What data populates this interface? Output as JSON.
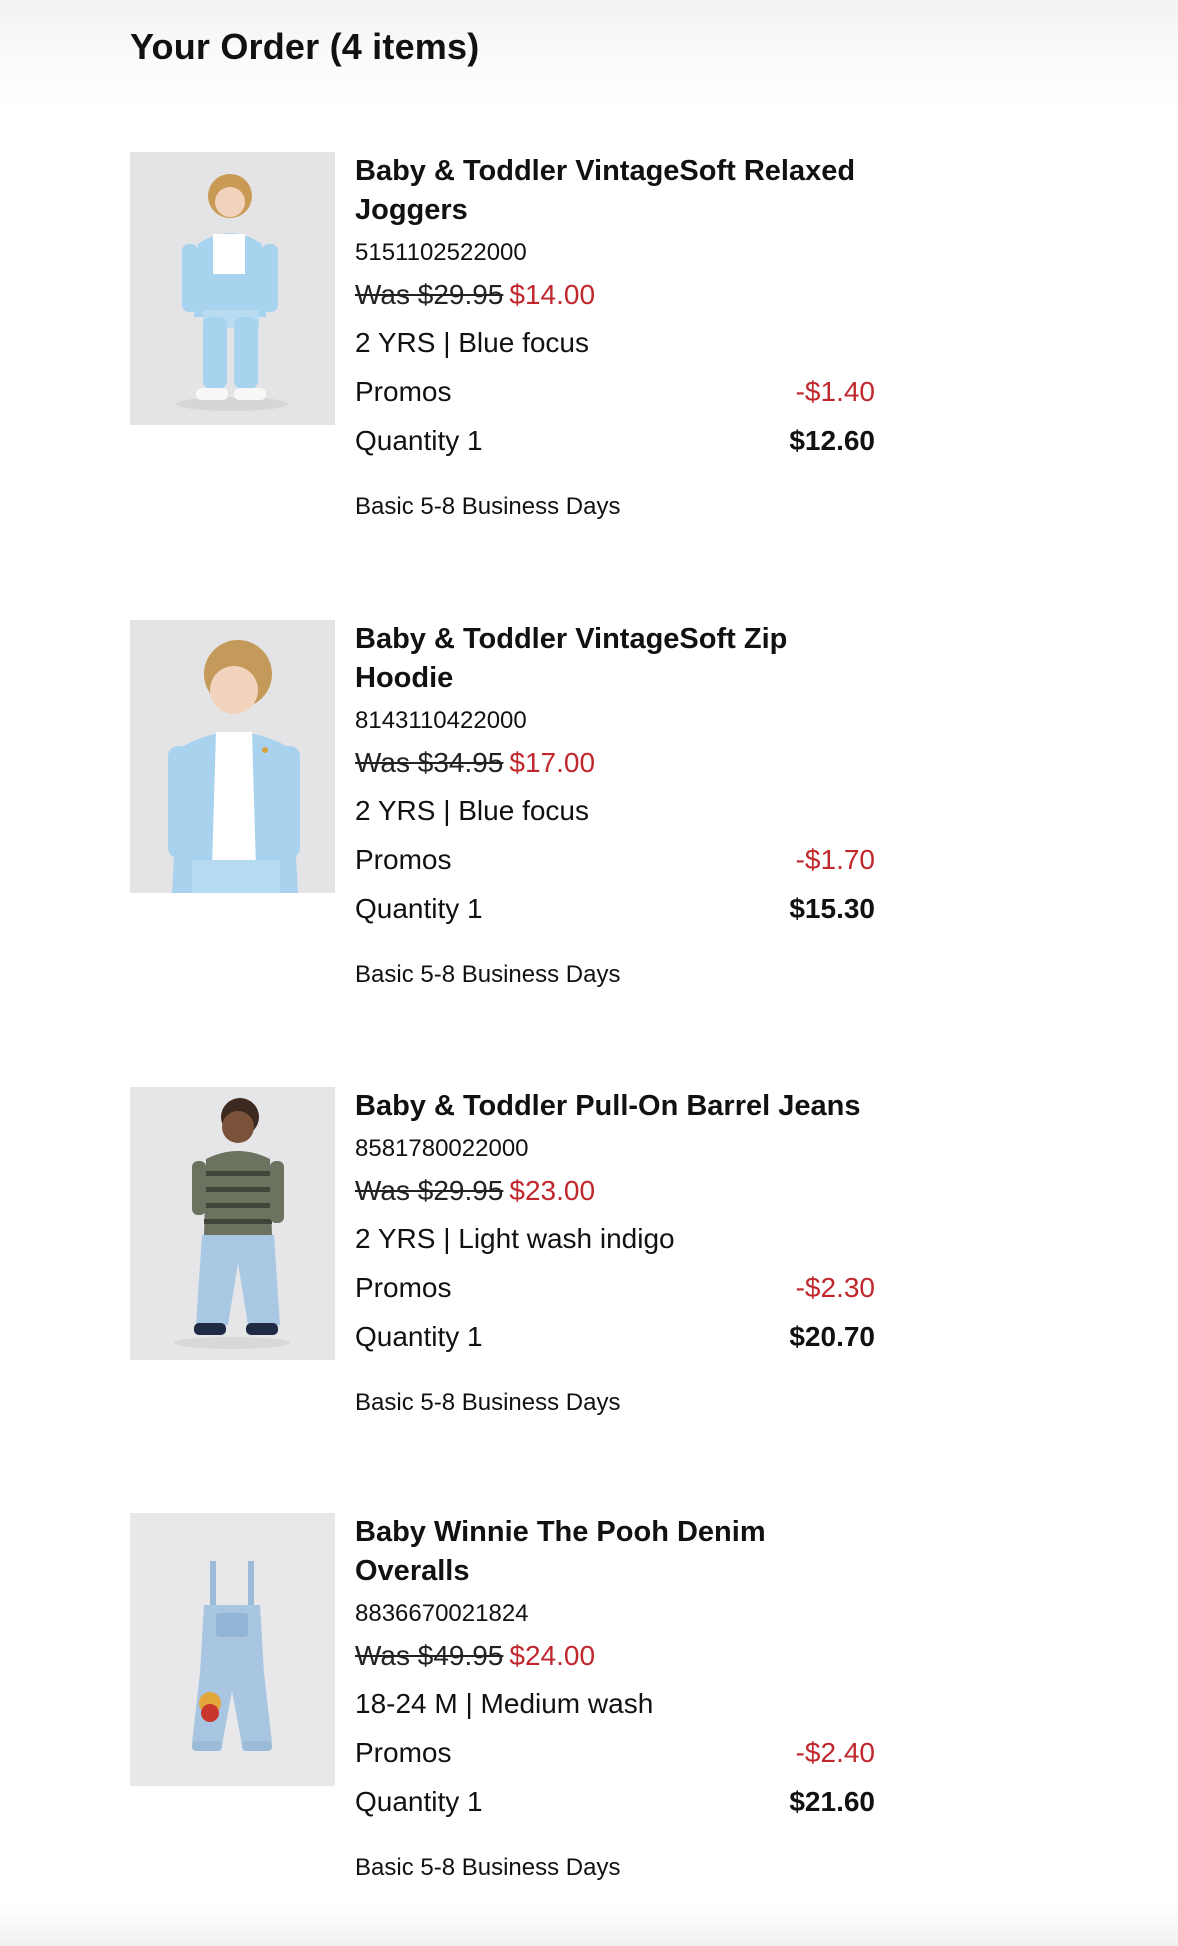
{
  "header": {
    "title": "Your Order (4 items)"
  },
  "items": [
    {
      "name": "Baby & Toddler VintageSoft Relaxed Joggers",
      "sku": "5151102522000",
      "was_price": "Was $29.95",
      "sale_price": "$14.00",
      "variant": "2 YRS | Blue focus",
      "promos_label": "Promos",
      "promos_value": "-$1.40",
      "quantity_label": "Quantity 1",
      "line_total": "$12.60",
      "shipping": "Basic 5-8 Business Days",
      "image": "toddler-blue-joggers-outfit"
    },
    {
      "name": "Baby & Toddler VintageSoft Zip Hoodie",
      "sku": "8143110422000",
      "was_price": "Was $34.95",
      "sale_price": "$17.00",
      "variant": "2 YRS | Blue focus",
      "promos_label": "Promos",
      "promos_value": "-$1.70",
      "quantity_label": "Quantity 1",
      "line_total": "$15.30",
      "shipping": "Basic 5-8 Business Days",
      "image": "toddler-blue-zip-hoodie"
    },
    {
      "name": "Baby & Toddler Pull-On Barrel Jeans",
      "sku": "8581780022000",
      "was_price": "Was $29.95",
      "sale_price": "$23.00",
      "variant": "2 YRS | Light wash indigo",
      "promos_label": "Promos",
      "promos_value": "-$2.30",
      "quantity_label": "Quantity 1",
      "line_total": "$20.70",
      "shipping": "Basic 5-8 Business Days",
      "image": "toddler-barrel-jeans"
    },
    {
      "name": "Baby Winnie The Pooh Denim Overalls",
      "sku": "8836670021824",
      "was_price": "Was $49.95",
      "sale_price": "$24.00",
      "variant": "18-24 M | Medium wash",
      "promos_label": "Promos",
      "promos_value": "-$2.40",
      "quantity_label": "Quantity 1",
      "line_total": "$21.60",
      "shipping": "Basic 5-8 Business Days",
      "image": "denim-overalls"
    }
  ],
  "colors": {
    "sale": "#c0282d",
    "text": "#111111",
    "thumb_bg": "#e4e4e6"
  }
}
